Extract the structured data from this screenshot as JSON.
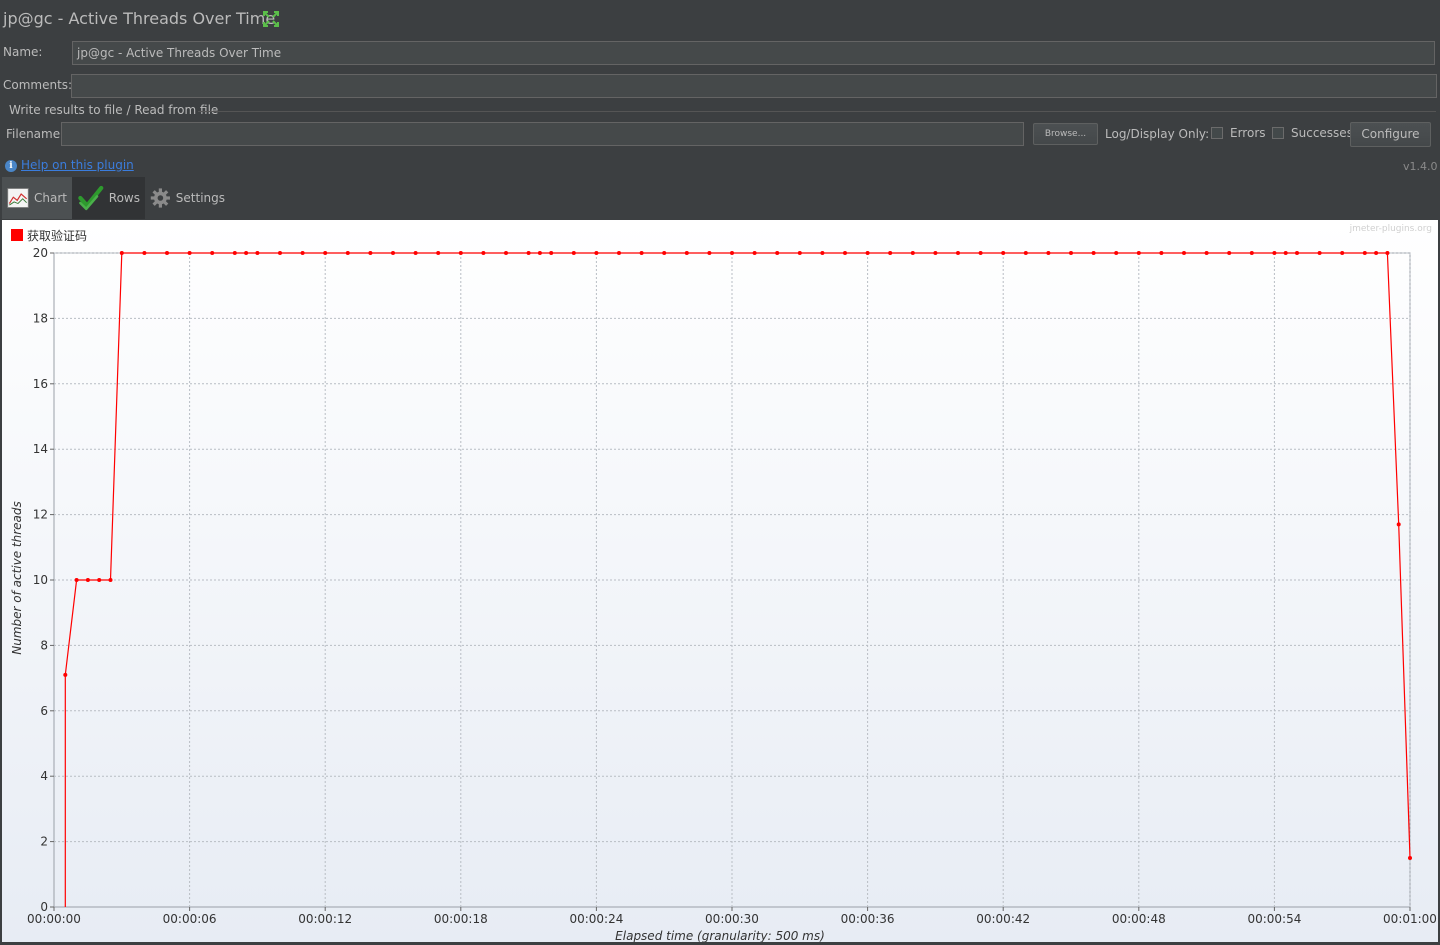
{
  "window": {
    "title": "jp@gc - Active Threads Over Time"
  },
  "form": {
    "name_label": "Name:",
    "name_value": "jp@gc - Active Threads Over Time",
    "comments_label": "Comments:",
    "comments_value": "",
    "section_title": "Write results to file / Read from file",
    "filename_label": "Filename",
    "filename_value": "",
    "browse_label": "Browse...",
    "log_display_label": "Log/Display Only:",
    "errors_label": "Errors",
    "successes_label": "Successes",
    "configure_label": "Configure"
  },
  "help": {
    "link_text": "Help on this plugin",
    "version": "v1.4.0"
  },
  "tabs": [
    {
      "label": "Chart",
      "icon": "chart-icon",
      "active": true
    },
    {
      "label": "Rows",
      "icon": "checkmark-icon",
      "active": false
    },
    {
      "label": "Settings",
      "icon": "gear-icon",
      "active": false
    }
  ],
  "chart_data": {
    "type": "line",
    "watermark": "jmeter-plugins.org",
    "xlabel": "Elapsed time (granularity: 500 ms)",
    "ylabel": "Number of active threads",
    "xlim": [
      "00:00:00",
      "00:01:00"
    ],
    "ylim": [
      0,
      20
    ],
    "grid": true,
    "legend_position": "top-left",
    "x_ticks": [
      "00:00:00",
      "00:00:06",
      "00:00:12",
      "00:00:18",
      "00:00:24",
      "00:00:30",
      "00:00:36",
      "00:00:42",
      "00:00:48",
      "00:00:54",
      "00:01:00"
    ],
    "y_ticks": [
      0,
      2,
      4,
      6,
      8,
      10,
      12,
      14,
      16,
      18,
      20
    ],
    "series": [
      {
        "name": "获取验证码",
        "color": "#ff0000",
        "x": [
          "00:00:00.5",
          "00:00:00.5",
          "00:00:01",
          "00:00:01.5",
          "00:00:02",
          "00:00:02.5",
          "00:00:03",
          "00:00:04",
          "00:00:05",
          "00:00:06",
          "00:00:07",
          "00:00:08",
          "00:00:08.5",
          "00:00:09",
          "00:00:10",
          "00:00:11",
          "00:00:12",
          "00:00:13",
          "00:00:14",
          "00:00:15",
          "00:00:16",
          "00:00:17",
          "00:00:18",
          "00:00:19",
          "00:00:20",
          "00:00:21",
          "00:00:21.5",
          "00:00:22",
          "00:00:23",
          "00:00:24",
          "00:00:25",
          "00:00:26",
          "00:00:27",
          "00:00:28",
          "00:00:29",
          "00:00:30",
          "00:00:31",
          "00:00:32",
          "00:00:33",
          "00:00:34",
          "00:00:35",
          "00:00:36",
          "00:00:37",
          "00:00:38",
          "00:00:39",
          "00:00:40",
          "00:00:41",
          "00:00:42",
          "00:00:43",
          "00:00:44",
          "00:00:45",
          "00:00:46",
          "00:00:47",
          "00:00:48",
          "00:00:49",
          "00:00:50",
          "00:00:51",
          "00:00:52",
          "00:00:53",
          "00:00:54",
          "00:00:54.5",
          "00:00:55",
          "00:00:56",
          "00:00:57",
          "00:00:58",
          "00:00:58.5",
          "00:00:59",
          "00:00:59.5",
          "00:01:00"
        ],
        "values": [
          0,
          7.1,
          10,
          10,
          10,
          10,
          20,
          20,
          20,
          20,
          20,
          20,
          20,
          20,
          20,
          20,
          20,
          20,
          20,
          20,
          20,
          20,
          20,
          20,
          20,
          20,
          20,
          20,
          20,
          20,
          20,
          20,
          20,
          20,
          20,
          20,
          20,
          20,
          20,
          20,
          20,
          20,
          20,
          20,
          20,
          20,
          20,
          20,
          20,
          20,
          20,
          20,
          20,
          20,
          20,
          20,
          20,
          20,
          20,
          20,
          20,
          20,
          20,
          20,
          20,
          20,
          20,
          11.7,
          1.5
        ]
      }
    ]
  }
}
